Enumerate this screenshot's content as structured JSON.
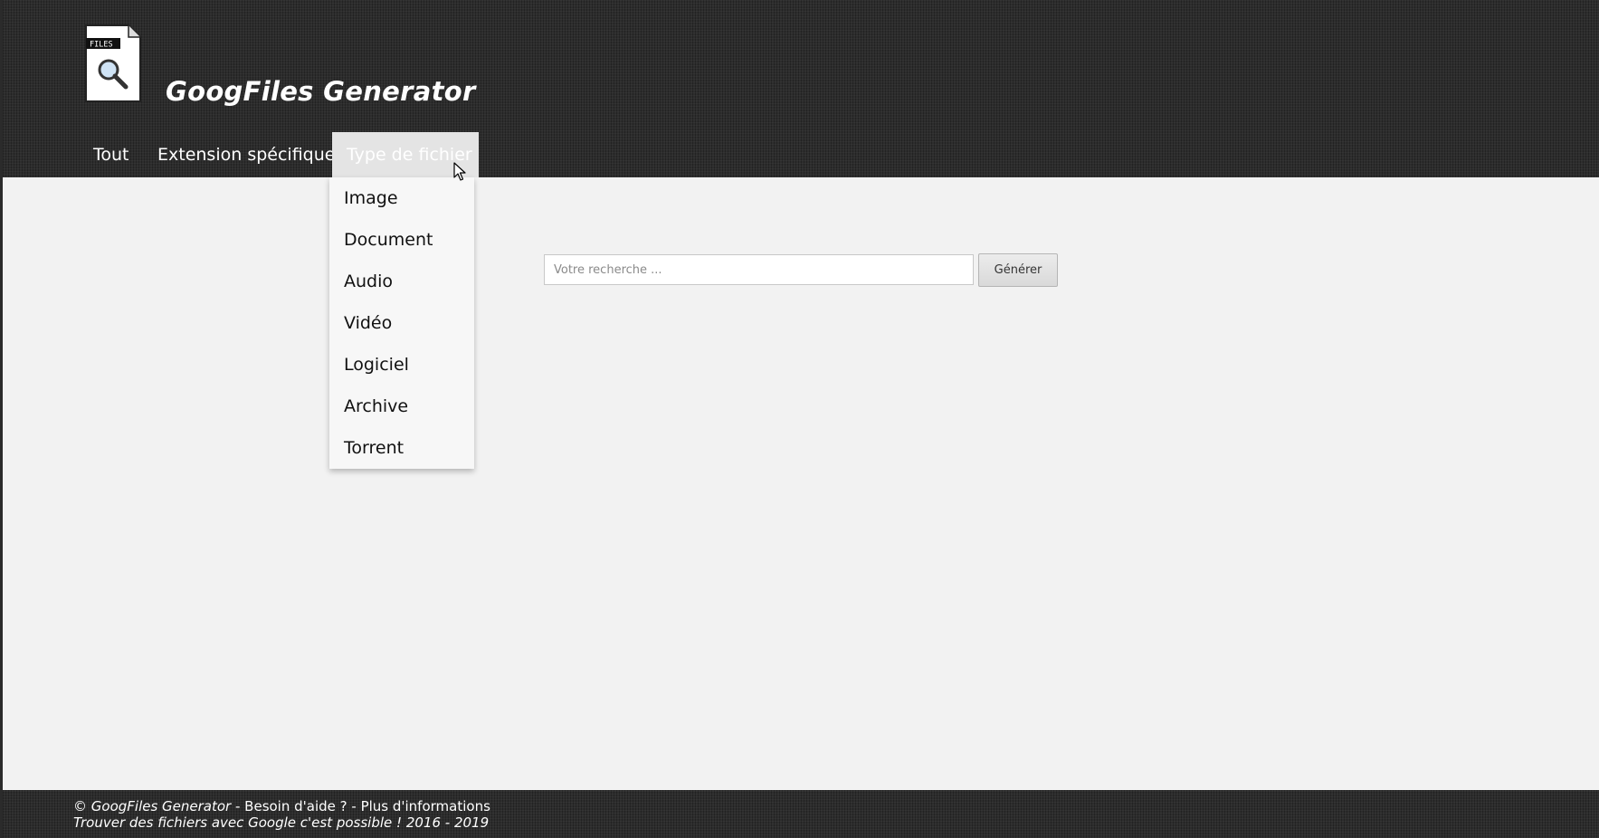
{
  "header": {
    "logo_label": "FILES",
    "title": "GoogFiles Generator"
  },
  "nav": {
    "items": [
      {
        "label": "Tout"
      },
      {
        "label": "Extension spécifique"
      },
      {
        "label": "Type de fichier",
        "active": true
      }
    ]
  },
  "dropdown": {
    "items": [
      {
        "label": "Image"
      },
      {
        "label": "Document"
      },
      {
        "label": "Audio"
      },
      {
        "label": "Vidéo"
      },
      {
        "label": "Logiciel"
      },
      {
        "label": "Archive"
      },
      {
        "label": "Torrent"
      }
    ]
  },
  "search": {
    "placeholder": "Votre recherche ...",
    "value": "",
    "button_label": "Générer"
  },
  "footer": {
    "copyright": "© GoogFiles Generator",
    "separator1": " - ",
    "help_link": "Besoin d'aide ?",
    "separator2": " - ",
    "info_link": "Plus d'informations",
    "tagline": "Trouver des fichiers avec Google c'est possible ! 2016 - 2019"
  },
  "colors": {
    "header_bg": "#2d2d2d",
    "page_bg": "#f2f2f2",
    "active_tab_bg": "#e4e4e4",
    "dropdown_bg": "#f7f7f7"
  }
}
